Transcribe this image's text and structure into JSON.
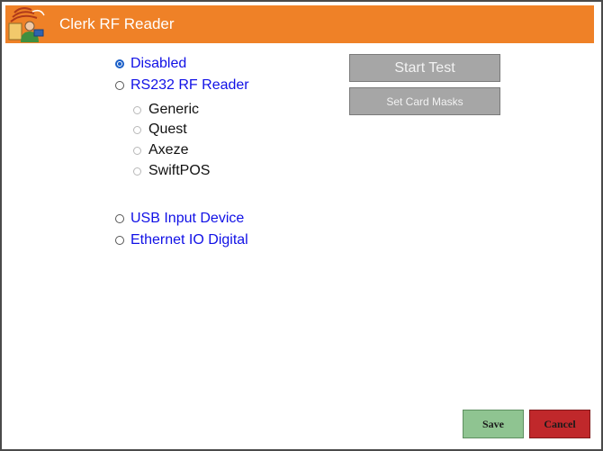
{
  "window": {
    "title": "Clerk RF Reader"
  },
  "app_icon": "clerk-rf-reader-icon",
  "reader_options": {
    "disabled": {
      "label": "Disabled",
      "checked": true
    },
    "rs232": {
      "label": "RS232 RF Reader",
      "checked": false
    },
    "rs232_types": [
      {
        "label": "Generic",
        "checked": false
      },
      {
        "label": "Quest",
        "checked": false
      },
      {
        "label": "Axeze",
        "checked": false
      },
      {
        "label": "SwiftPOS",
        "checked": false
      }
    ],
    "usb": {
      "label": "USB Input Device",
      "checked": false
    },
    "ethernet": {
      "label": "Ethernet IO Digital",
      "checked": false
    }
  },
  "buttons": {
    "start_test": "Start Test",
    "set_card_masks": "Set Card Masks",
    "save": "Save",
    "cancel": "Cancel"
  },
  "colors": {
    "title_bar": "#ef8127",
    "option_text": "#1010e6",
    "save_button": "#8fc491",
    "cancel_button": "#c0282b",
    "disabled_button": "#a6a6a6"
  }
}
